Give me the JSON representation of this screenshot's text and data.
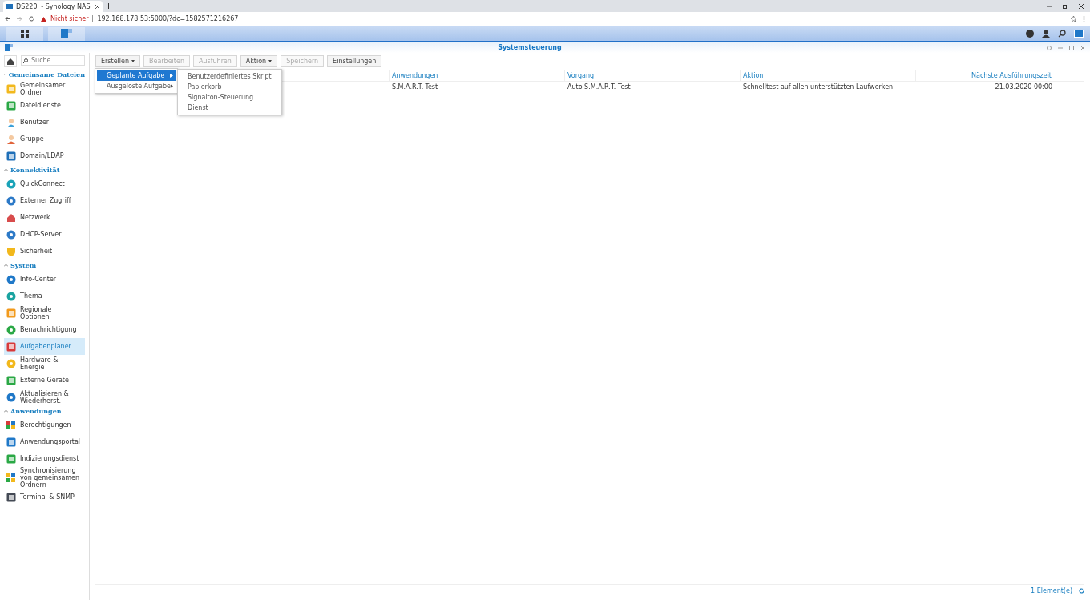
{
  "browser": {
    "tab_title": "DS220j - Synology NAS",
    "security": "Nicht sicher",
    "url": "192.168.178.53:5000/?dc=1582571216267"
  },
  "window": {
    "title": "Systemsteuerung"
  },
  "sidebar": {
    "search": {
      "placeholder": "Suche"
    },
    "sections": [
      {
        "title": "Gemeinsame Dateien",
        "expanded": true,
        "items": [
          {
            "label": "Gemeinsamer Ordner",
            "selected": false
          },
          {
            "label": "Dateidienste",
            "selected": false
          },
          {
            "label": "Benutzer",
            "selected": false
          },
          {
            "label": "Gruppe",
            "selected": false
          },
          {
            "label": "Domain/LDAP",
            "selected": false
          }
        ]
      },
      {
        "title": "Konnektivität",
        "expanded": true,
        "items": [
          {
            "label": "QuickConnect",
            "selected": false
          },
          {
            "label": "Externer Zugriff",
            "selected": false
          },
          {
            "label": "Netzwerk",
            "selected": false
          },
          {
            "label": "DHCP-Server",
            "selected": false
          },
          {
            "label": "Sicherheit",
            "selected": false
          }
        ]
      },
      {
        "title": "System",
        "expanded": true,
        "items": [
          {
            "label": "Info-Center",
            "selected": false
          },
          {
            "label": "Thema",
            "selected": false
          },
          {
            "label": "Regionale Optionen",
            "selected": false
          },
          {
            "label": "Benachrichtigung",
            "selected": false
          },
          {
            "label": "Aufgabenplaner",
            "selected": true
          },
          {
            "label": "Hardware & Energie",
            "selected": false
          },
          {
            "label": "Externe Geräte",
            "selected": false
          },
          {
            "label": "Aktualisieren & Wiederherst.",
            "selected": false
          }
        ]
      },
      {
        "title": "Anwendungen",
        "expanded": true,
        "items": [
          {
            "label": "Berechtigungen",
            "selected": false
          },
          {
            "label": "Anwendungsportal",
            "selected": false
          },
          {
            "label": "Indizierungsdienst",
            "selected": false
          },
          {
            "label": "Synchronisierung von gemeinsamen Ordnern",
            "selected": false
          },
          {
            "label": "Terminal & SNMP",
            "selected": false
          }
        ]
      }
    ]
  },
  "toolbar": [
    {
      "label": "Erstellen",
      "disabled": false,
      "dropdown": true
    },
    {
      "label": "Bearbeiten",
      "disabled": true,
      "dropdown": false
    },
    {
      "label": "Ausführen",
      "disabled": true,
      "dropdown": false
    },
    {
      "label": "Aktion",
      "disabled": false,
      "dropdown": true
    },
    {
      "label": "Speichern",
      "disabled": true,
      "dropdown": false
    },
    {
      "label": "Einstellungen",
      "disabled": false,
      "dropdown": false
    }
  ],
  "menu": {
    "items": [
      {
        "label": "Geplante Aufgabe",
        "selected": true
      },
      {
        "label": "Ausgelöste Aufgabe",
        "selected": false
      }
    ],
    "submenu": [
      "Benutzerdefiniertes Skript",
      "Papierkorb",
      "Signalton-Steuerung",
      "Dienst"
    ]
  },
  "table": {
    "columns": [
      "Anwendungen",
      "Vorgang",
      "Aktion",
      "Nächste Ausführungszeit"
    ],
    "rows": [
      [
        "S.M.A.R.T.-Test",
        "Auto S.M.A.R.T. Test",
        "Schnelltest auf allen unterstützten Laufwerken",
        "21.03.2020 00:00"
      ]
    ]
  },
  "status_bar": {
    "count": "1 Element(e)"
  }
}
